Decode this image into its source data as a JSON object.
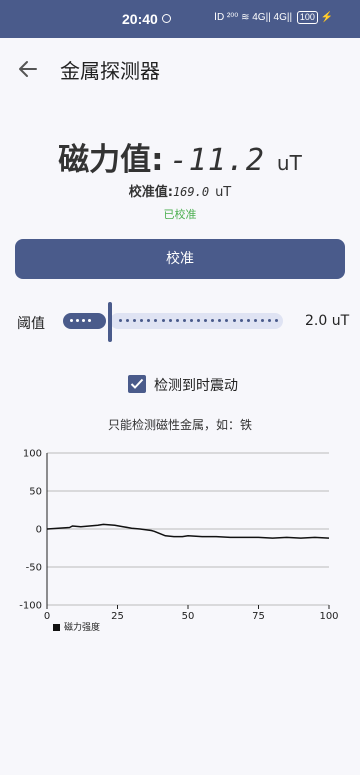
{
  "status_bar": {
    "time": "20:40",
    "icons": "ⅠD ²⁰⁰ ≋ 4G|| 4G||",
    "battery": "100"
  },
  "app_bar": {
    "title": "金属探测器",
    "back_icon": "arrow-left-icon"
  },
  "reading": {
    "label": "磁力值:",
    "value": "-11.2",
    "unit": "uT"
  },
  "calibration": {
    "label": "校准值:",
    "value": "169.0",
    "unit": "uT",
    "status": "已校准"
  },
  "calibrate_button": {
    "label": "校准"
  },
  "threshold": {
    "label": "阈值",
    "value_text": "2.0 uT",
    "level_fraction": 0.2
  },
  "vibrate": {
    "label": "检测到时震动",
    "checked": true
  },
  "hint": "只能检测磁性金属，如：铁",
  "colors": {
    "accent": "#4a5b8b",
    "calibrated": "#4caf50",
    "line": "#111111"
  },
  "chart_data": {
    "type": "line",
    "xlim": [
      0,
      100
    ],
    "ylim": [
      -100,
      100
    ],
    "xticks": [
      0,
      25,
      50,
      75,
      100
    ],
    "yticks": [
      100,
      50,
      0,
      -50,
      -100
    ],
    "grid": "horizontal",
    "legend_position": "bottom-left",
    "series": [
      {
        "name": "磁力强度",
        "x": [
          0,
          4,
          8,
          9,
          12,
          15,
          18,
          20,
          24,
          27,
          30,
          33,
          37,
          38,
          40,
          42,
          45,
          48,
          50,
          55,
          60,
          65,
          70,
          75,
          80,
          85,
          90,
          95,
          100
        ],
        "y": [
          0,
          1,
          2,
          4,
          3,
          4,
          5,
          6,
          5,
          3,
          1,
          0,
          -2,
          -3,
          -6,
          -9,
          -10,
          -10,
          -9,
          -10,
          -10,
          -11,
          -11,
          -11,
          -12,
          -11,
          -12,
          -11,
          -12
        ]
      }
    ]
  }
}
